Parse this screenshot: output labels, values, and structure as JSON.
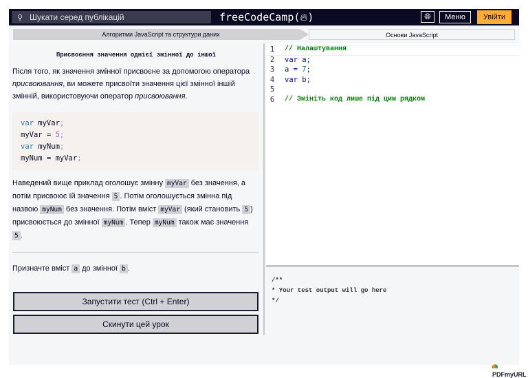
{
  "navbar": {
    "search_placeholder": "Шукати серед публікацій",
    "logo": "freeCodeCamp(🔥)",
    "logo_text": "freeCodeCamp(",
    "logo_end": ")",
    "menu_label": "Меню",
    "signin_label": "Увійти",
    "accent_color": "#feac32"
  },
  "breadcrumb": [
    "Алгоритми JavaScript та структури даних",
    "Основи JavaScript"
  ],
  "lesson": {
    "title": "Присвоєння значення однієї змінної до іншої",
    "p1": [
      "Після того, як значення змінної присвоєне за допомогою оператора ",
      "присвоювання",
      ", ви можете присвоїти значення цієї змінної іншій змінній, використовуючи оператор ",
      "присвоювання",
      "."
    ],
    "example_code": [
      [
        "var",
        " myVar",
        ";"
      ],
      [
        "myVar = ",
        "5",
        ";"
      ],
      [
        "var",
        " myNum",
        ";"
      ],
      [
        "myNum = myVar",
        ";"
      ]
    ],
    "p2": [
      "Наведений вище приклад оголошує змінну ",
      "myVar",
      " без значення, а потім присвоює їй значення ",
      "5",
      ". Потім оголошується змінна під назвою ",
      "myNum",
      " без значення. Потім вміст ",
      "myVar",
      " (який становить ",
      "5",
      ") присвоюється до змінної ",
      "myNum",
      ". Тепер ",
      "myNum",
      " також має значення ",
      "5",
      "."
    ],
    "task": [
      "Призначте вміст ",
      "a",
      " до змінної ",
      "b",
      "."
    ]
  },
  "buttons": {
    "run": "Запустити тест (Ctrl + Enter)",
    "reset": "Скинути цей урок",
    "third": "..."
  },
  "editor": {
    "lines": [
      "1",
      "2",
      "3",
      "4",
      "5",
      "6"
    ],
    "l1": "// Налаштування",
    "l2a": "var",
    "l2b": " a;",
    "l3a": "a = ",
    "l3b": "7",
    "l3c": ";",
    "l4a": "var",
    "l4b": " b;",
    "l6": "// Змініть код лише під цим рядком"
  },
  "output": "/**\n* Your test output will go here\n*/",
  "watermark": "PDFmyURL"
}
